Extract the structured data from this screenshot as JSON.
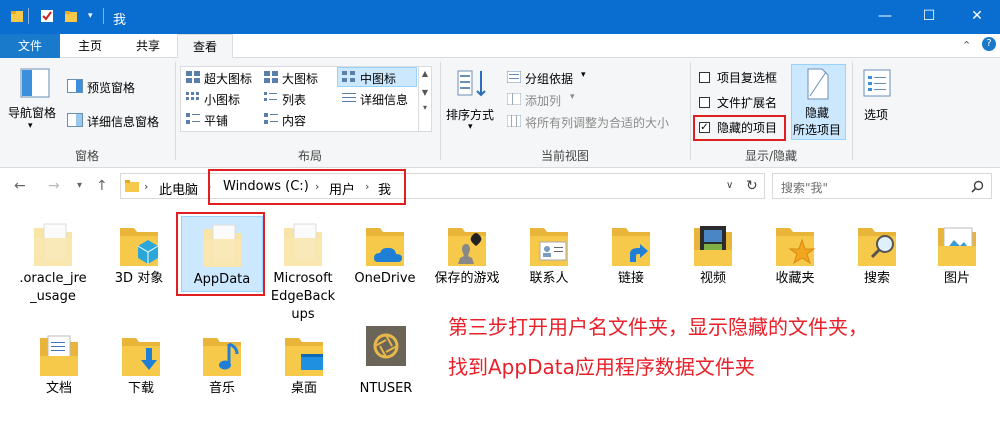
{
  "window": {
    "title": "我",
    "minimize": "—",
    "maximize": "☐",
    "close": "✕"
  },
  "tabs": [
    {
      "label": "文件"
    },
    {
      "label": "主页"
    },
    {
      "label": "共享"
    },
    {
      "label": "查看"
    }
  ],
  "ribbon": {
    "panes": {
      "nav_pane": "导航窗格",
      "preview_pane": "预览窗格",
      "details_pane": "详细信息窗格",
      "group": "窗格"
    },
    "layout": {
      "items": [
        "超大图标",
        "大图标",
        "中图标",
        "小图标",
        "列表",
        "详细信息",
        "平铺",
        "内容"
      ],
      "selected": "中图标",
      "group": "布局"
    },
    "current_view": {
      "sort": "排序方式",
      "group_by": "分组依据",
      "add_column": "添加列",
      "fit_columns": "将所有列调整为合适的大小",
      "group": "当前视图"
    },
    "show_hide": {
      "item_checkboxes": "项目复选框",
      "file_extensions": "文件扩展名",
      "hidden_items": "隐藏的项目",
      "hidden_items_checked": true,
      "hide_selected_1": "隐藏",
      "hide_selected_2": "所选项目",
      "options": "选项",
      "group": "显示/隐藏"
    }
  },
  "address": {
    "crumbs": [
      "此电脑",
      "Windows (C:)",
      "用户",
      "我"
    ],
    "search_placeholder": "搜索\"我\""
  },
  "items": [
    {
      "label": ".oracle_jre_usage",
      "line1": ".oracle_jre",
      "line2": "_usage"
    },
    {
      "label": "3D 对象"
    },
    {
      "label": "AppData"
    },
    {
      "label": "Microsoft EdgeBackups",
      "line1": "Microsoft",
      "line2": "EdgeBack",
      "line3": "ups"
    },
    {
      "label": "OneDrive"
    },
    {
      "label": "保存的游戏"
    },
    {
      "label": "联系人"
    },
    {
      "label": "链接"
    },
    {
      "label": "视频"
    },
    {
      "label": "收藏夹"
    },
    {
      "label": "搜索"
    },
    {
      "label": "图片"
    },
    {
      "label": "文档"
    },
    {
      "label": "下载"
    },
    {
      "label": "音乐"
    },
    {
      "label": "桌面"
    },
    {
      "label": "NTUSER"
    }
  ],
  "annotation": {
    "line1": "第三步打开用户名文件夹，显示隐藏的文件夹，",
    "line2": "找到AppData应用程序数据文件夹"
  },
  "colors": {
    "titlebar": "#0a6ed1",
    "file_tab": "#1979ca",
    "highlight": "#e02020",
    "annotation": "#e8202a",
    "folder": "#f6c94a"
  }
}
